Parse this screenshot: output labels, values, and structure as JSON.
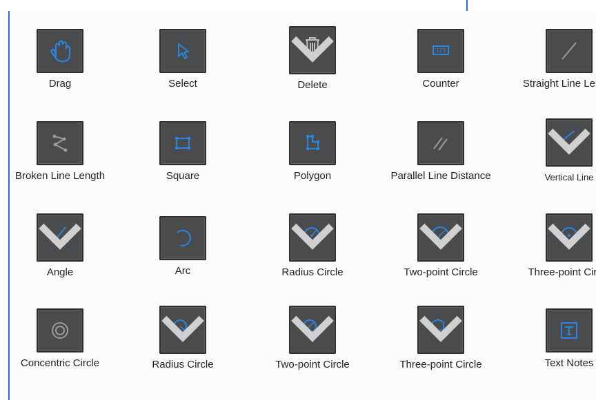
{
  "colors": {
    "frame": "#2a6fd6",
    "button_bg": "#4a4b4d",
    "icon_blue": "#2b84e0",
    "icon_gray": "#9a9b9e"
  },
  "tools": [
    {
      "label": "Drag",
      "icon": "hand-icon",
      "caret": false
    },
    {
      "label": "Select",
      "icon": "cursor-icon",
      "caret": false
    },
    {
      "label": "Delete",
      "icon": "trash-icon",
      "caret": true
    },
    {
      "label": "Counter",
      "icon": "counter-icon",
      "caret": false
    },
    {
      "label": "Straight Line Length",
      "icon": "straight-line-icon",
      "caret": false
    },
    {
      "label": "Broken Line Length",
      "icon": "broken-line-icon",
      "caret": false
    },
    {
      "label": "Square",
      "icon": "square-icon",
      "caret": false
    },
    {
      "label": "Polygon",
      "icon": "polygon-icon",
      "caret": false
    },
    {
      "label": "Parallel Line Distance",
      "icon": "parallel-lines-icon",
      "caret": false
    },
    {
      "label": "Vertical Line",
      "icon": "vertical-line-icon",
      "caret": true
    },
    {
      "label": "Angle",
      "icon": "angle-icon",
      "caret": true
    },
    {
      "label": "Arc",
      "icon": "arc-icon",
      "caret": false
    },
    {
      "label": "Radius Circle",
      "icon": "radius-circle-icon",
      "caret": true
    },
    {
      "label": "Two-point Circle",
      "icon": "two-point-circle-icon",
      "caret": true
    },
    {
      "label": "Three-point Circle",
      "icon": "three-point-circle-icon",
      "caret": true
    },
    {
      "label": "Concentric Circle",
      "icon": "concentric-circle-icon",
      "caret": false
    },
    {
      "label": "Radius Circle",
      "icon": "radius-circle-2-icon",
      "caret": true
    },
    {
      "label": "Two-point Circle",
      "icon": "two-point-circle-2-icon",
      "caret": true
    },
    {
      "label": "Three-point Circle",
      "icon": "three-point-circle-2-icon",
      "caret": true
    },
    {
      "label": "Text Notes",
      "icon": "text-notes-icon",
      "caret": false
    }
  ]
}
